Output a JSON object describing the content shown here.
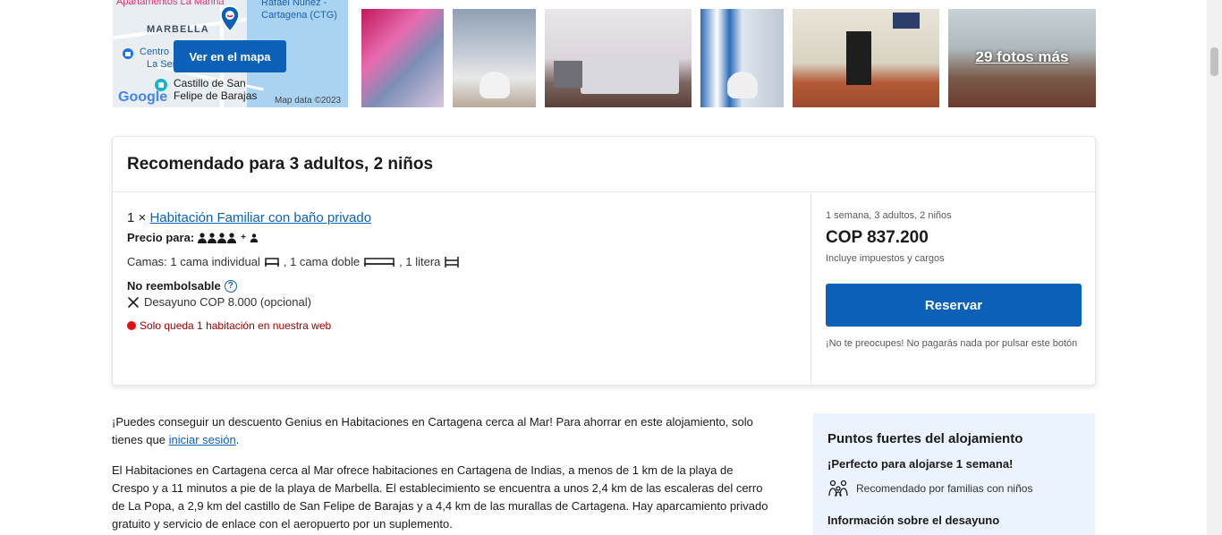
{
  "map": {
    "button_label": "Ver en el mapa",
    "labels": [
      "Apartamentos La Marina",
      "MARBELLA",
      "Rafael Núñez - Cartagena (CTG)",
      "Centro",
      "La Ser",
      "Castillo de San",
      "Felipe de Barajas"
    ],
    "google_label": "Google",
    "map_data": "Map data ©2023"
  },
  "gallery": {
    "more_photos": "29 fotos más"
  },
  "recommended": {
    "title": "Recomendado para 3 adultos, 2 niños",
    "quantity": "1 ×",
    "room_name": "Habitación Familiar con baño privado",
    "price_for_label": "Precio para:",
    "beds_prefix": "Camas: 1 cama individual",
    "bed_double": ", 1 cama doble",
    "bed_bunk": ", 1 litera",
    "non_refundable": "No reembolsable",
    "breakfast": "Desayuno COP 8.000 (opcional)",
    "scarcity": "Solo queda 1 habitación en nuestra web",
    "stay_summary": "1 semana, 3 adultos, 2 niños",
    "price": "COP 837.200",
    "taxes": "Incluye impuestos y cargos",
    "reserve_label": "Reservar",
    "reserve_note": "¡No te preocupes! No pagarás nada por pulsar este botón"
  },
  "description": {
    "p1_before": "¡Puedes conseguir un descuento Genius en Habitaciones en Cartagena cerca al Mar! Para ahorrar en este alojamiento, solo tienes que ",
    "p1_link": "iniciar sesión",
    "p1_after": ".",
    "p2": "El Habitaciones en Cartagena cerca al Mar ofrece habitaciones en Cartagena de Indias, a menos de 1 km de la playa de Crespo y a 11 minutos a pie de la playa de Marbella. El establecimiento se encuentra a unos 2,4 km de las escaleras del cerro de La Popa, a 2,9 km del castillo de San Felipe de Barajas y a 4,4 km de las murallas de Cartagena. Hay aparcamiento privado gratuito y servicio de enlace con el aeropuerto por un suplemento."
  },
  "highlights": {
    "title": "Puntos fuertes del alojamiento",
    "subtitle": "¡Perfecto para alojarse 1 semana!",
    "item": "Recomendado por familias con niños",
    "breakfast_info": "Información sobre el desayuno"
  },
  "colors": {
    "brand_blue": "#0a61b7",
    "scarcity_red": "#a30000",
    "highlight_bg": "#ebf3ff"
  }
}
